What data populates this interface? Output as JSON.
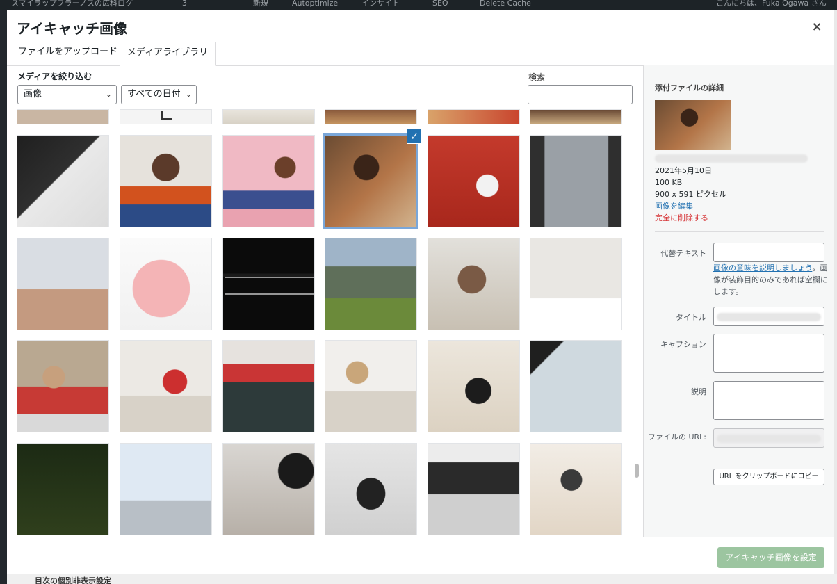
{
  "admin_bar": {
    "site": "スマイラップフラーノスの広科ログ",
    "updates": "3",
    "new": "新規",
    "autoptimize": "Autoptimize",
    "insight": "インサイト",
    "seo": "SEO",
    "cache": "Delete Cache",
    "greeting": "こんにちは、Fuka Ogawa さん"
  },
  "modal": {
    "title": "アイキャッチ画像",
    "close_icon": "×",
    "tabs": [
      {
        "label": "ファイルをアップロード",
        "active": false
      },
      {
        "label": "メディアライブラリ",
        "active": true
      }
    ]
  },
  "filters": {
    "label": "メディアを絞り込む",
    "type": {
      "value": "画像",
      "options": [
        "画像"
      ]
    },
    "date": {
      "value": "すべての日付",
      "options": [
        "すべての日付"
      ]
    },
    "search_label": "検索",
    "search_value": ""
  },
  "attachment_details": {
    "heading": "添付ファイルの詳細",
    "date": "2021年5月10日",
    "size": "100 KB",
    "dimensions": "900 x 591 ピクセル",
    "edit_link": "画像を編集",
    "delete_link": "完全に削除する",
    "alt_label": "代替テキスト",
    "alt_value": "",
    "alt_help_link": "画像の意味を説明しましょう",
    "alt_help_suffix": "。",
    "alt_help_text": "画像が装飾目的のみであれば空欄にします。",
    "title_label": "タイトル",
    "caption_label": "キャプション",
    "description_label": "説明",
    "url_label": "ファイルの URL:",
    "copy_button": "URL をクリップボードにコピー"
  },
  "footer": {
    "set_button": "アイキャッチ画像を設定"
  },
  "background_footer": {
    "text": "目次の個別非表示設定"
  },
  "colors": {
    "accent": "#2271b1",
    "danger": "#d63638",
    "primary_disabled": "#9cc5a0"
  }
}
